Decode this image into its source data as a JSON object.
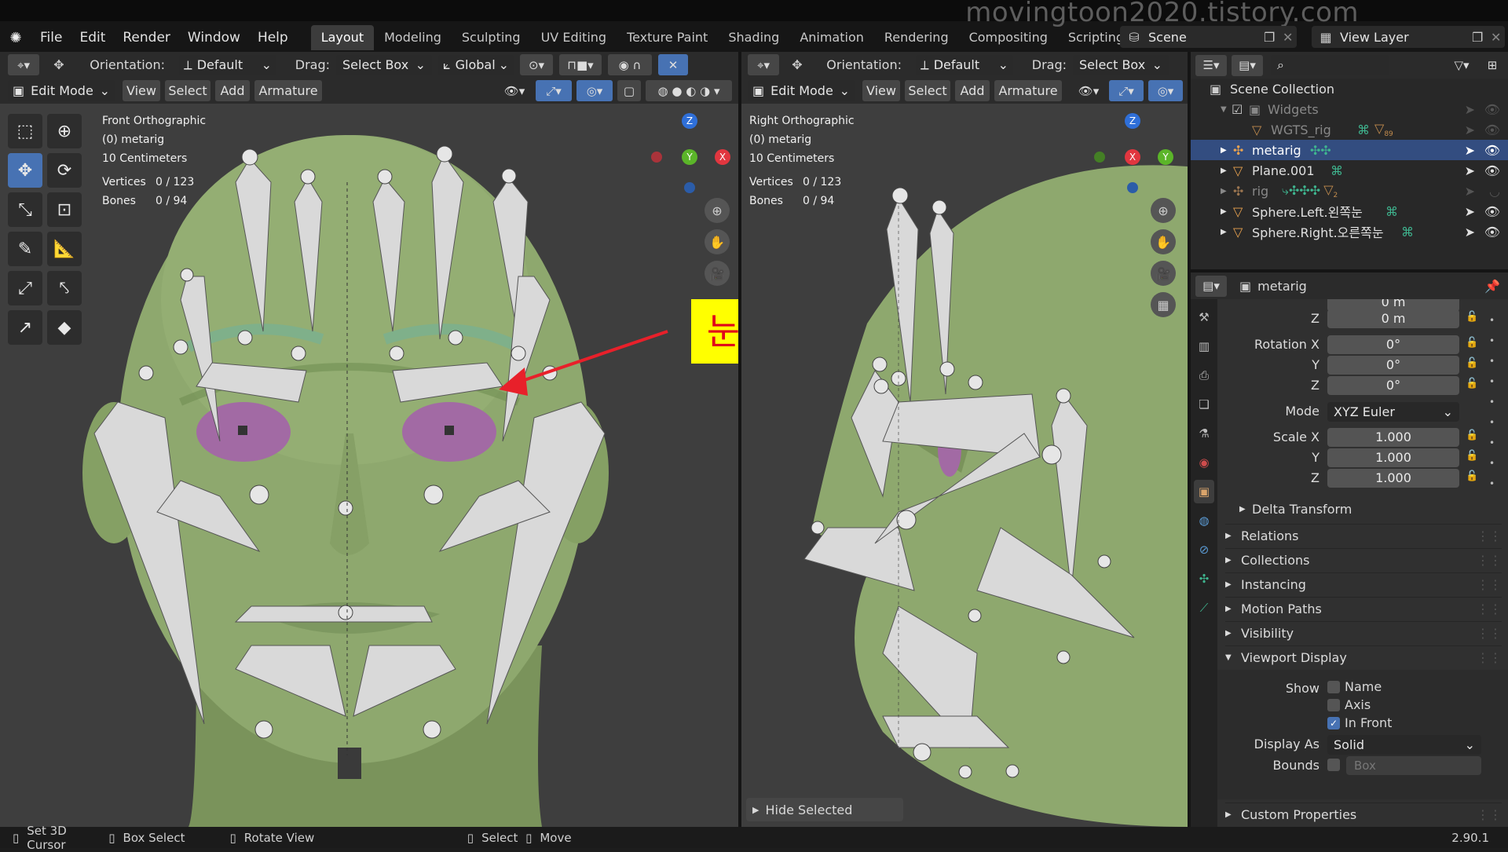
{
  "watermark": "movingtoon2020.tistory.com",
  "menubar": {
    "items": [
      "File",
      "Edit",
      "Render",
      "Window",
      "Help"
    ],
    "workspace_tabs": [
      "Layout",
      "Modeling",
      "Sculpting",
      "UV Editing",
      "Texture Paint",
      "Shading",
      "Animation",
      "Rendering",
      "Compositing",
      "Scripting"
    ],
    "active_tab": "Layout",
    "add_tab": "+",
    "scene": "Scene",
    "view_layer": "View Layer"
  },
  "viewport_left": {
    "orientation_label": "Orientation:",
    "orientation_value": "Default",
    "drag_label": "Drag:",
    "drag_value": "Select Box",
    "transform_space": "Global",
    "mode": "Edit Mode",
    "menus": [
      "View",
      "Select",
      "Add",
      "Armature"
    ],
    "view_name": "Front Orthographic",
    "object": "(0) metarig",
    "scale": "10 Centimeters",
    "vertices_label": "Vertices",
    "vertices_value": "0 / 123",
    "bones_label": "Bones",
    "bones_value": "0 / 94",
    "annotation": "눈꺼풀과 눈썹의 경계선",
    "gizmo": {
      "z": "Z",
      "y": "Y",
      "x": "X"
    }
  },
  "viewport_right": {
    "orientation_label": "Orientation:",
    "orientation_value": "Default",
    "drag_label": "Drag:",
    "drag_value": "Select Box",
    "mode": "Edit Mode",
    "menus": [
      "View",
      "Select",
      "Add",
      "Armature"
    ],
    "view_name": "Right Orthographic",
    "object": "(0) metarig",
    "scale": "10 Centimeters",
    "vertices_label": "Vertices",
    "vertices_value": "0 / 123",
    "bones_label": "Bones",
    "bones_value": "0 / 94",
    "hide_selected": "Hide Selected",
    "gizmo": {
      "z": "Z",
      "y": "Y",
      "x": "X"
    }
  },
  "outliner": {
    "root": "Scene Collection",
    "items": [
      {
        "label": "Widgets",
        "dim": true
      },
      {
        "label": "WGTS_rig",
        "dim": true,
        "badge": "89"
      },
      {
        "label": "metarig",
        "selected": true
      },
      {
        "label": "Plane.001"
      },
      {
        "label": "rig",
        "dim": true,
        "badge": "2"
      },
      {
        "label": "Sphere.Left.왼쪽눈"
      },
      {
        "label": "Sphere.Right.오른쪽눈"
      }
    ]
  },
  "properties": {
    "object_name": "metarig",
    "partial_label": "0 m",
    "location_z_label": "Z",
    "location_z": "0 m",
    "rotation_x_label": "Rotation X",
    "rotation_x": "0°",
    "rotation_y_label": "Y",
    "rotation_y": "0°",
    "rotation_z_label": "Z",
    "rotation_z": "0°",
    "mode_label": "Mode",
    "mode_value": "XYZ Euler",
    "scale_x_label": "Scale X",
    "scale_x": "1.000",
    "scale_y_label": "Y",
    "scale_y": "1.000",
    "scale_z_label": "Z",
    "scale_z": "1.000",
    "panels": [
      "Delta Transform",
      "Relations",
      "Collections",
      "Instancing",
      "Motion Paths",
      "Visibility",
      "Viewport Display"
    ],
    "show_label": "Show",
    "show_name": "Name",
    "show_axis": "Axis",
    "show_in_front": "In Front",
    "in_front_checked": true,
    "display_as_label": "Display As",
    "display_as_value": "Solid",
    "bounds_label": "Bounds",
    "bounds_value": "Box",
    "custom_properties": "Custom Properties",
    "version": "2.90.1"
  },
  "statusbar": {
    "set_cursor": "Set 3D Cursor",
    "box_select": "Box Select",
    "rotate_view": "Rotate View",
    "select": "Select",
    "move": "Move"
  },
  "colors": {
    "accent": "#4772b3",
    "skin": "#8ea86e",
    "eye": "#a26aa4",
    "annotation_bg": "#ffff00",
    "annotation_text": "#e0001a",
    "arrow": "#e8202a",
    "selected_row": "#334d80"
  }
}
